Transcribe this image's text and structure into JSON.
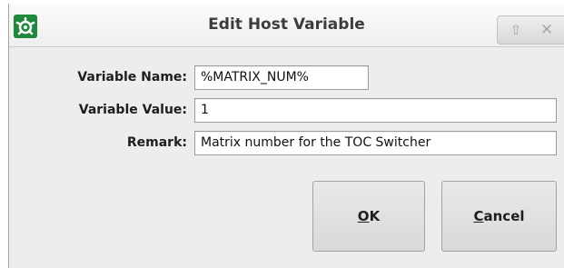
{
  "window": {
    "title": "Edit Host Variable",
    "title_buttons": {
      "restore_glyph": "⇧",
      "close_glyph": "✕"
    }
  },
  "form": {
    "variable_name": {
      "label": "Variable Name:",
      "value": "%MATRIX_NUM%"
    },
    "variable_value": {
      "label": "Variable Value:",
      "value": "1"
    },
    "remark": {
      "label": "Remark:",
      "value": "Matrix number for the TOC Switcher"
    }
  },
  "buttons": {
    "ok": {
      "mnemonic": "O",
      "rest": "K"
    },
    "cancel": {
      "mnemonic": "C",
      "rest": "ancel"
    }
  },
  "colors": {
    "accent": "#1c8a3a"
  }
}
